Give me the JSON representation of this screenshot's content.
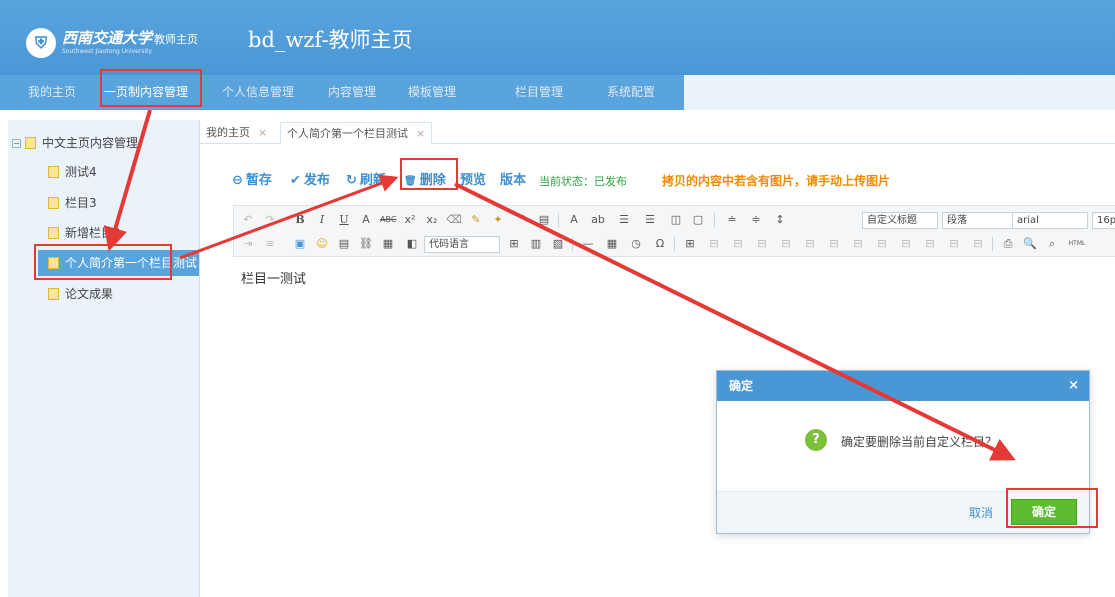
{
  "header": {
    "logo_glyph": "⛨",
    "university_name": "西南交通大学",
    "university_en": "Southwest Jiaotong University",
    "subtitle": "教师主页",
    "site_title": "bd_wzf-教师主页"
  },
  "nav": {
    "items": [
      {
        "label": "我的主页"
      },
      {
        "label": "一页制内容管理"
      },
      {
        "label": "个人信息管理"
      },
      {
        "label": "内容管理"
      },
      {
        "label": "模板管理"
      },
      {
        "label": "栏目管理"
      },
      {
        "label": "系统配置"
      }
    ],
    "active_index": 1
  },
  "sidebar": {
    "root": {
      "label": "中文主页内容管理",
      "toggle": "−"
    },
    "items": [
      {
        "label": "测试4"
      },
      {
        "label": "栏目3"
      },
      {
        "label": "新增栏目2"
      },
      {
        "label": "个人简介第一个栏目测试"
      },
      {
        "label": "论文成果"
      }
    ],
    "selected_index": 3
  },
  "tabs": [
    {
      "label": "我的主页",
      "close": "×"
    },
    {
      "label": "个人简介第一个栏目测试",
      "close": "×"
    }
  ],
  "actions": {
    "save_draft": {
      "icon": "⊖",
      "label": "暂存"
    },
    "publish": {
      "icon": "✔",
      "label": "发布"
    },
    "refresh": {
      "icon": "↻",
      "label": "刷新"
    },
    "delete": {
      "icon": "🗑",
      "label": "删除"
    },
    "preview": {
      "label": "预览"
    },
    "version": {
      "label": "版本"
    },
    "status": "当前状态：已发布",
    "warning": "拷贝的内容中若含有图片，请手动上传图片"
  },
  "toolbar": {
    "code_language": "代码语言",
    "custom_heading": "自定义标题",
    "paragraph": "段落",
    "font": "arial",
    "font_size": "16p",
    "html_label": "HTML"
  },
  "editor": {
    "content": "栏目一测试"
  },
  "dialog": {
    "title": "确定",
    "close": "×",
    "question_icon": "?",
    "message": "确定要删除当前自定义栏目？",
    "cancel": "取消",
    "ok": "确定"
  },
  "colors": {
    "header_blue": "#4a97d6",
    "annotation_red": "#e53935",
    "ok_green": "#5dbb2e",
    "warning_orange": "#f08a00",
    "status_green": "#2aa13c"
  }
}
